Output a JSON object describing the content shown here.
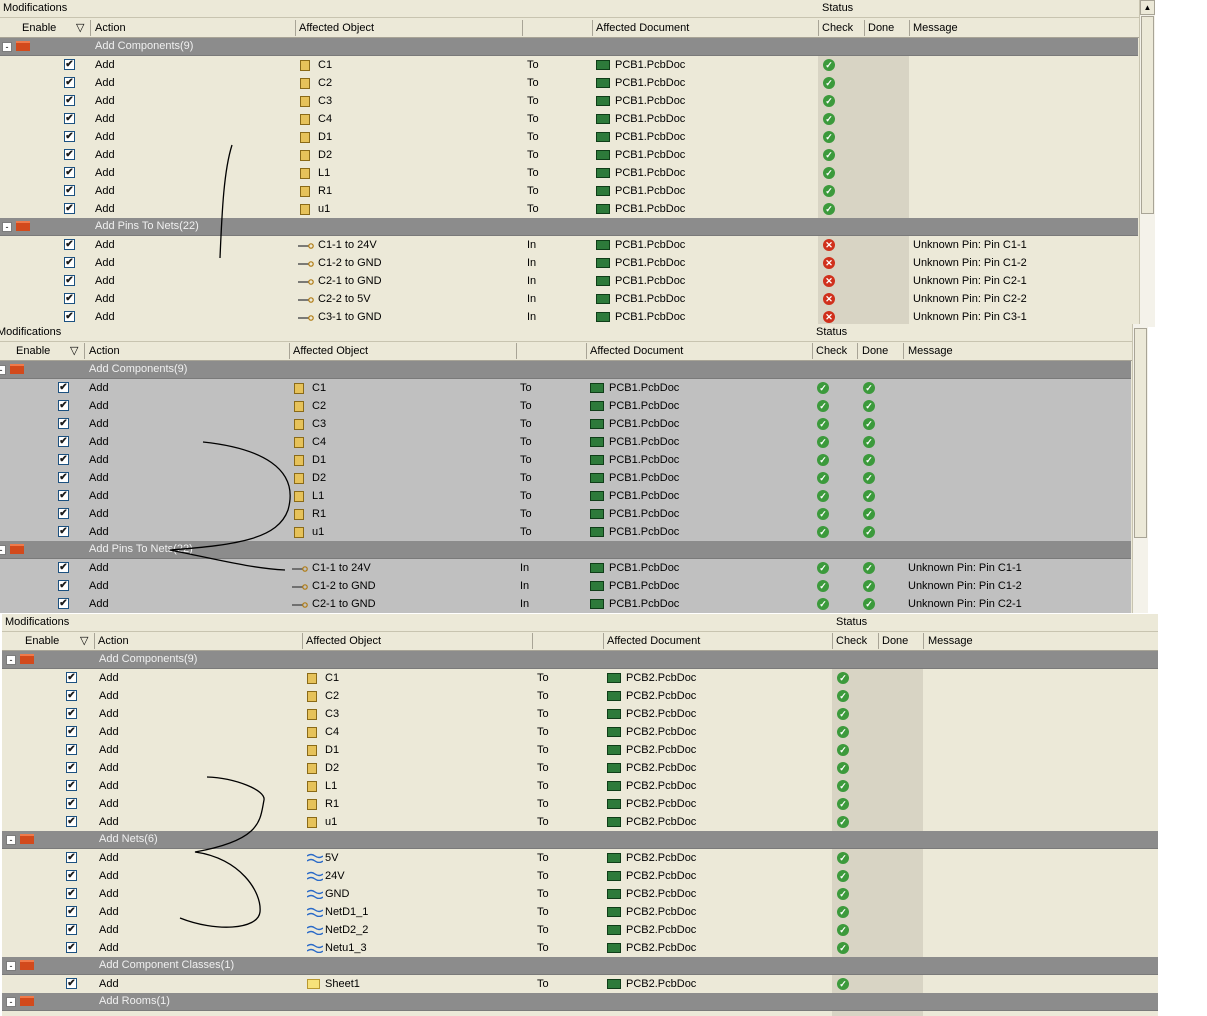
{
  "panel1": {
    "title": "Modifications",
    "status_title": "Status",
    "headers": {
      "enable": "Enable",
      "action": "Action",
      "object": "Affected Object",
      "document": "Affected Document",
      "check": "Check",
      "done": "Done",
      "message": "Message"
    },
    "groups": [
      {
        "label": "Add Components(9)",
        "rows": [
          {
            "enable": "✔",
            "action": "Add",
            "object": "C1",
            "prep": "To",
            "doc": "PCB1.PcbDoc",
            "check": "ok",
            "message": ""
          },
          {
            "enable": "✔",
            "action": "Add",
            "object": "C2",
            "prep": "To",
            "doc": "PCB1.PcbDoc",
            "check": "ok",
            "message": ""
          },
          {
            "enable": "✔",
            "action": "Add",
            "object": "C3",
            "prep": "To",
            "doc": "PCB1.PcbDoc",
            "check": "ok",
            "message": ""
          },
          {
            "enable": "✔",
            "action": "Add",
            "object": "C4",
            "prep": "To",
            "doc": "PCB1.PcbDoc",
            "check": "ok",
            "message": ""
          },
          {
            "enable": "✔",
            "action": "Add",
            "object": "D1",
            "prep": "To",
            "doc": "PCB1.PcbDoc",
            "check": "ok",
            "message": ""
          },
          {
            "enable": "✔",
            "action": "Add",
            "object": "D2",
            "prep": "To",
            "doc": "PCB1.PcbDoc",
            "check": "ok",
            "message": ""
          },
          {
            "enable": "✔",
            "action": "Add",
            "object": "L1",
            "prep": "To",
            "doc": "PCB1.PcbDoc",
            "check": "ok",
            "message": ""
          },
          {
            "enable": "✔",
            "action": "Add",
            "object": "R1",
            "prep": "To",
            "doc": "PCB1.PcbDoc",
            "check": "ok",
            "message": ""
          },
          {
            "enable": "✔",
            "action": "Add",
            "object": "u1",
            "prep": "To",
            "doc": "PCB1.PcbDoc",
            "check": "ok",
            "message": ""
          }
        ]
      },
      {
        "label": "Add Pins To Nets(22)",
        "rows": [
          {
            "enable": "✔",
            "action": "Add",
            "object": "C1-1 to 24V",
            "prep": "In",
            "doc": "PCB1.PcbDoc",
            "check": "err",
            "message": "Unknown Pin: Pin C1-1"
          },
          {
            "enable": "✔",
            "action": "Add",
            "object": "C1-2 to GND",
            "prep": "In",
            "doc": "PCB1.PcbDoc",
            "check": "err",
            "message": "Unknown Pin: Pin C1-2"
          },
          {
            "enable": "✔",
            "action": "Add",
            "object": "C2-1 to GND",
            "prep": "In",
            "doc": "PCB1.PcbDoc",
            "check": "err",
            "message": "Unknown Pin: Pin C2-1"
          },
          {
            "enable": "✔",
            "action": "Add",
            "object": "C2-2 to 5V",
            "prep": "In",
            "doc": "PCB1.PcbDoc",
            "check": "err",
            "message": "Unknown Pin: Pin C2-2"
          },
          {
            "enable": "✔",
            "action": "Add",
            "object": "C3-1 to GND",
            "prep": "In",
            "doc": "PCB1.PcbDoc",
            "check": "err",
            "message": "Unknown Pin: Pin C3-1"
          }
        ]
      }
    ]
  },
  "panel2": {
    "title": "Modifications",
    "status_title": "Status",
    "headers": {
      "enable": "Enable",
      "action": "Action",
      "object": "Affected Object",
      "document": "Affected Document",
      "check": "Check",
      "done": "Done",
      "message": "Message"
    },
    "groups": [
      {
        "label": "Add Components(9)",
        "rows": [
          {
            "enable": "✔",
            "action": "Add",
            "object": "C1",
            "prep": "To",
            "doc": "PCB1.PcbDoc",
            "check": "ok",
            "done": "ok",
            "message": ""
          },
          {
            "enable": "✔",
            "action": "Add",
            "object": "C2",
            "prep": "To",
            "doc": "PCB1.PcbDoc",
            "check": "ok",
            "done": "ok",
            "message": ""
          },
          {
            "enable": "✔",
            "action": "Add",
            "object": "C3",
            "prep": "To",
            "doc": "PCB1.PcbDoc",
            "check": "ok",
            "done": "ok",
            "message": ""
          },
          {
            "enable": "✔",
            "action": "Add",
            "object": "C4",
            "prep": "To",
            "doc": "PCB1.PcbDoc",
            "check": "ok",
            "done": "ok",
            "message": ""
          },
          {
            "enable": "✔",
            "action": "Add",
            "object": "D1",
            "prep": "To",
            "doc": "PCB1.PcbDoc",
            "check": "ok",
            "done": "ok",
            "message": ""
          },
          {
            "enable": "✔",
            "action": "Add",
            "object": "D2",
            "prep": "To",
            "doc": "PCB1.PcbDoc",
            "check": "ok",
            "done": "ok",
            "message": ""
          },
          {
            "enable": "✔",
            "action": "Add",
            "object": "L1",
            "prep": "To",
            "doc": "PCB1.PcbDoc",
            "check": "ok",
            "done": "ok",
            "message": ""
          },
          {
            "enable": "✔",
            "action": "Add",
            "object": "R1",
            "prep": "To",
            "doc": "PCB1.PcbDoc",
            "check": "ok",
            "done": "ok",
            "message": ""
          },
          {
            "enable": "✔",
            "action": "Add",
            "object": "u1",
            "prep": "To",
            "doc": "PCB1.PcbDoc",
            "check": "ok",
            "done": "ok",
            "message": ""
          }
        ]
      },
      {
        "label": "Add Pins To Nets(22)",
        "rows": [
          {
            "enable": "✔",
            "action": "Add",
            "object": "C1-1 to 24V",
            "prep": "In",
            "doc": "PCB1.PcbDoc",
            "check": "ok",
            "done": "ok",
            "message": "Unknown Pin: Pin C1-1"
          },
          {
            "enable": "✔",
            "action": "Add",
            "object": "C1-2 to GND",
            "prep": "In",
            "doc": "PCB1.PcbDoc",
            "check": "ok",
            "done": "ok",
            "message": "Unknown Pin: Pin C1-2"
          },
          {
            "enable": "✔",
            "action": "Add",
            "object": "C2-1 to GND",
            "prep": "In",
            "doc": "PCB1.PcbDoc",
            "check": "ok",
            "done": "ok",
            "message": "Unknown Pin: Pin C2-1"
          }
        ]
      }
    ]
  },
  "panel3": {
    "title": "Modifications",
    "status_title": "Status",
    "headers": {
      "enable": "Enable",
      "action": "Action",
      "object": "Affected Object",
      "document": "Affected Document",
      "check": "Check",
      "done": "Done",
      "message": "Message"
    },
    "groups": [
      {
        "label": "Add Components(9)",
        "rows": [
          {
            "enable": "✔",
            "action": "Add",
            "object": "C1",
            "prep": "To",
            "doc": "PCB2.PcbDoc",
            "check": "ok"
          },
          {
            "enable": "✔",
            "action": "Add",
            "object": "C2",
            "prep": "To",
            "doc": "PCB2.PcbDoc",
            "check": "ok"
          },
          {
            "enable": "✔",
            "action": "Add",
            "object": "C3",
            "prep": "To",
            "doc": "PCB2.PcbDoc",
            "check": "ok"
          },
          {
            "enable": "✔",
            "action": "Add",
            "object": "C4",
            "prep": "To",
            "doc": "PCB2.PcbDoc",
            "check": "ok"
          },
          {
            "enable": "✔",
            "action": "Add",
            "object": "D1",
            "prep": "To",
            "doc": "PCB2.PcbDoc",
            "check": "ok"
          },
          {
            "enable": "✔",
            "action": "Add",
            "object": "D2",
            "prep": "To",
            "doc": "PCB2.PcbDoc",
            "check": "ok"
          },
          {
            "enable": "✔",
            "action": "Add",
            "object": "L1",
            "prep": "To",
            "doc": "PCB2.PcbDoc",
            "check": "ok"
          },
          {
            "enable": "✔",
            "action": "Add",
            "object": "R1",
            "prep": "To",
            "doc": "PCB2.PcbDoc",
            "check": "ok"
          },
          {
            "enable": "✔",
            "action": "Add",
            "object": "u1",
            "prep": "To",
            "doc": "PCB2.PcbDoc",
            "check": "ok"
          }
        ]
      },
      {
        "label": "Add Nets(6)",
        "rows": [
          {
            "enable": "✔",
            "action": "Add",
            "object": "5V",
            "prep": "To",
            "doc": "PCB2.PcbDoc",
            "check": "ok"
          },
          {
            "enable": "✔",
            "action": "Add",
            "object": "24V",
            "prep": "To",
            "doc": "PCB2.PcbDoc",
            "check": "ok"
          },
          {
            "enable": "✔",
            "action": "Add",
            "object": "GND",
            "prep": "To",
            "doc": "PCB2.PcbDoc",
            "check": "ok"
          },
          {
            "enable": "✔",
            "action": "Add",
            "object": "NetD1_1",
            "prep": "To",
            "doc": "PCB2.PcbDoc",
            "check": "ok"
          },
          {
            "enable": "✔",
            "action": "Add",
            "object": "NetD2_2",
            "prep": "To",
            "doc": "PCB2.PcbDoc",
            "check": "ok"
          },
          {
            "enable": "✔",
            "action": "Add",
            "object": "Netu1_3",
            "prep": "To",
            "doc": "PCB2.PcbDoc",
            "check": "ok"
          }
        ]
      },
      {
        "label": "Add Component Classes(1)",
        "rows": [
          {
            "enable": "✔",
            "action": "Add",
            "object": "Sheet1",
            "prep": "To",
            "doc": "PCB2.PcbDoc",
            "check": "ok"
          }
        ]
      },
      {
        "label": "Add Rooms(1)",
        "rows": []
      }
    ]
  },
  "glyphs": {
    "expander": "⊟",
    "ok": "✓",
    "err": "✕",
    "scroll_up": "▲",
    "sort": "▽"
  },
  "colors": {
    "group_bg": "#8c8c8c",
    "panel_bg": "#ece9d8",
    "selected_bg": "#c0c0c0",
    "ok": "#3c9a3c",
    "err": "#d0301c",
    "ink": "#000000"
  }
}
